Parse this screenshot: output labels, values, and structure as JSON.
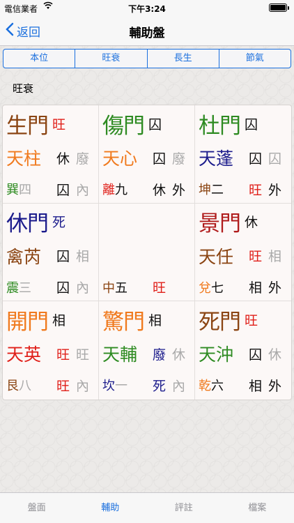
{
  "status": {
    "carrier": "電信業者",
    "time": "下午3:24",
    "wifi_icon": "wifi-icon",
    "battery_level": 1.0
  },
  "nav": {
    "back_label": "返回",
    "title": "輔助盤"
  },
  "segments": [
    "本位",
    "旺衰",
    "長生",
    "節氣"
  ],
  "section_label": "旺衰",
  "colors": {
    "brown": "#8b4513",
    "green": "#2e8b22",
    "navy": "#1c1c8c",
    "orange": "#f07a1e",
    "red": "#e0201a",
    "darkred": "#b01c1c",
    "black": "#111111",
    "gray": "#a9a9a9",
    "olive": "#7a6a1a"
  },
  "cells": [
    {
      "gate": {
        "text": "生門",
        "color": "brown"
      },
      "gate_state": {
        "text": "旺",
        "color": "red"
      },
      "star": {
        "text": "天柱",
        "color": "orange"
      },
      "star_s1": {
        "text": "休",
        "color": "black"
      },
      "star_s2": {
        "text": "廢",
        "color": "gray"
      },
      "palace_a": {
        "text": "巽",
        "color": "green"
      },
      "palace_b": {
        "text": "四",
        "color": "gray"
      },
      "palace_s1": {
        "text": "囚",
        "color": "black"
      },
      "palace_s2": {
        "text": "內",
        "color": "gray"
      }
    },
    {
      "gate": {
        "text": "傷門",
        "color": "green"
      },
      "gate_state": {
        "text": "囚",
        "color": "black"
      },
      "star": {
        "text": "天心",
        "color": "orange"
      },
      "star_s1": {
        "text": "囚",
        "color": "black"
      },
      "star_s2": {
        "text": "廢",
        "color": "gray"
      },
      "palace_a": {
        "text": "離",
        "color": "red"
      },
      "palace_b": {
        "text": "九",
        "color": "black"
      },
      "palace_s1": {
        "text": "休",
        "color": "black"
      },
      "palace_s2": {
        "text": "外",
        "color": "black"
      }
    },
    {
      "gate": {
        "text": "杜門",
        "color": "green"
      },
      "gate_state": {
        "text": "囚",
        "color": "black"
      },
      "star": {
        "text": "天蓬",
        "color": "navy"
      },
      "star_s1": {
        "text": "囚",
        "color": "black"
      },
      "star_s2": {
        "text": "囚",
        "color": "gray"
      },
      "palace_a": {
        "text": "坤",
        "color": "brown"
      },
      "palace_b": {
        "text": "二",
        "color": "black"
      },
      "palace_s1": {
        "text": "旺",
        "color": "red"
      },
      "palace_s2": {
        "text": "外",
        "color": "black"
      }
    },
    {
      "gate": {
        "text": "休門",
        "color": "navy"
      },
      "gate_state": {
        "text": "死",
        "color": "navy"
      },
      "star": {
        "text": "禽芮",
        "color": "brown"
      },
      "star_s1": {
        "text": "囚",
        "color": "black"
      },
      "star_s2": {
        "text": "相",
        "color": "gray"
      },
      "palace_a": {
        "text": "震",
        "color": "green"
      },
      "palace_b": {
        "text": "三",
        "color": "gray"
      },
      "palace_s1": {
        "text": "囚",
        "color": "black"
      },
      "palace_s2": {
        "text": "內",
        "color": "gray"
      }
    },
    {
      "gate": {
        "text": "",
        "color": "black"
      },
      "gate_state": {
        "text": "",
        "color": "black"
      },
      "star": {
        "text": "",
        "color": "black"
      },
      "star_s1": {
        "text": "",
        "color": "black"
      },
      "star_s2": {
        "text": "",
        "color": "black"
      },
      "palace_a": {
        "text": "中",
        "color": "brown"
      },
      "palace_b": {
        "text": "五",
        "color": "black"
      },
      "palace_s1": {
        "text": "旺",
        "color": "red"
      },
      "palace_s2": {
        "text": "",
        "color": "black"
      }
    },
    {
      "gate": {
        "text": "景門",
        "color": "darkred"
      },
      "gate_state": {
        "text": "休",
        "color": "black"
      },
      "star": {
        "text": "天任",
        "color": "brown"
      },
      "star_s1": {
        "text": "旺",
        "color": "red"
      },
      "star_s2": {
        "text": "相",
        "color": "gray"
      },
      "palace_a": {
        "text": "兌",
        "color": "orange"
      },
      "palace_b": {
        "text": "七",
        "color": "black"
      },
      "palace_s1": {
        "text": "相",
        "color": "black"
      },
      "palace_s2": {
        "text": "外",
        "color": "black"
      }
    },
    {
      "gate": {
        "text": "開門",
        "color": "orange"
      },
      "gate_state": {
        "text": "相",
        "color": "black"
      },
      "star": {
        "text": "天英",
        "color": "red"
      },
      "star_s1": {
        "text": "旺",
        "color": "red"
      },
      "star_s2": {
        "text": "旺",
        "color": "gray"
      },
      "palace_a": {
        "text": "艮",
        "color": "brown"
      },
      "palace_b": {
        "text": "八",
        "color": "gray"
      },
      "palace_s1": {
        "text": "旺",
        "color": "red"
      },
      "palace_s2": {
        "text": "內",
        "color": "gray"
      }
    },
    {
      "gate": {
        "text": "驚門",
        "color": "orange"
      },
      "gate_state": {
        "text": "相",
        "color": "black"
      },
      "star": {
        "text": "天輔",
        "color": "green"
      },
      "star_s1": {
        "text": "廢",
        "color": "navy"
      },
      "star_s2": {
        "text": "休",
        "color": "gray"
      },
      "palace_a": {
        "text": "坎",
        "color": "navy"
      },
      "palace_b": {
        "text": "一",
        "color": "gray"
      },
      "palace_s1": {
        "text": "死",
        "color": "navy"
      },
      "palace_s2": {
        "text": "內",
        "color": "gray"
      }
    },
    {
      "gate": {
        "text": "死門",
        "color": "brown"
      },
      "gate_state": {
        "text": "旺",
        "color": "red"
      },
      "star": {
        "text": "天沖",
        "color": "green"
      },
      "star_s1": {
        "text": "囚",
        "color": "black"
      },
      "star_s2": {
        "text": "休",
        "color": "gray"
      },
      "palace_a": {
        "text": "乾",
        "color": "orange"
      },
      "palace_b": {
        "text": "六",
        "color": "black"
      },
      "palace_s1": {
        "text": "相",
        "color": "black"
      },
      "palace_s2": {
        "text": "外",
        "color": "black"
      }
    }
  ],
  "tabs": [
    {
      "label": "盤面",
      "active": false
    },
    {
      "label": "輔助",
      "active": true
    },
    {
      "label": "評註",
      "active": false
    },
    {
      "label": "檔案",
      "active": false
    }
  ]
}
